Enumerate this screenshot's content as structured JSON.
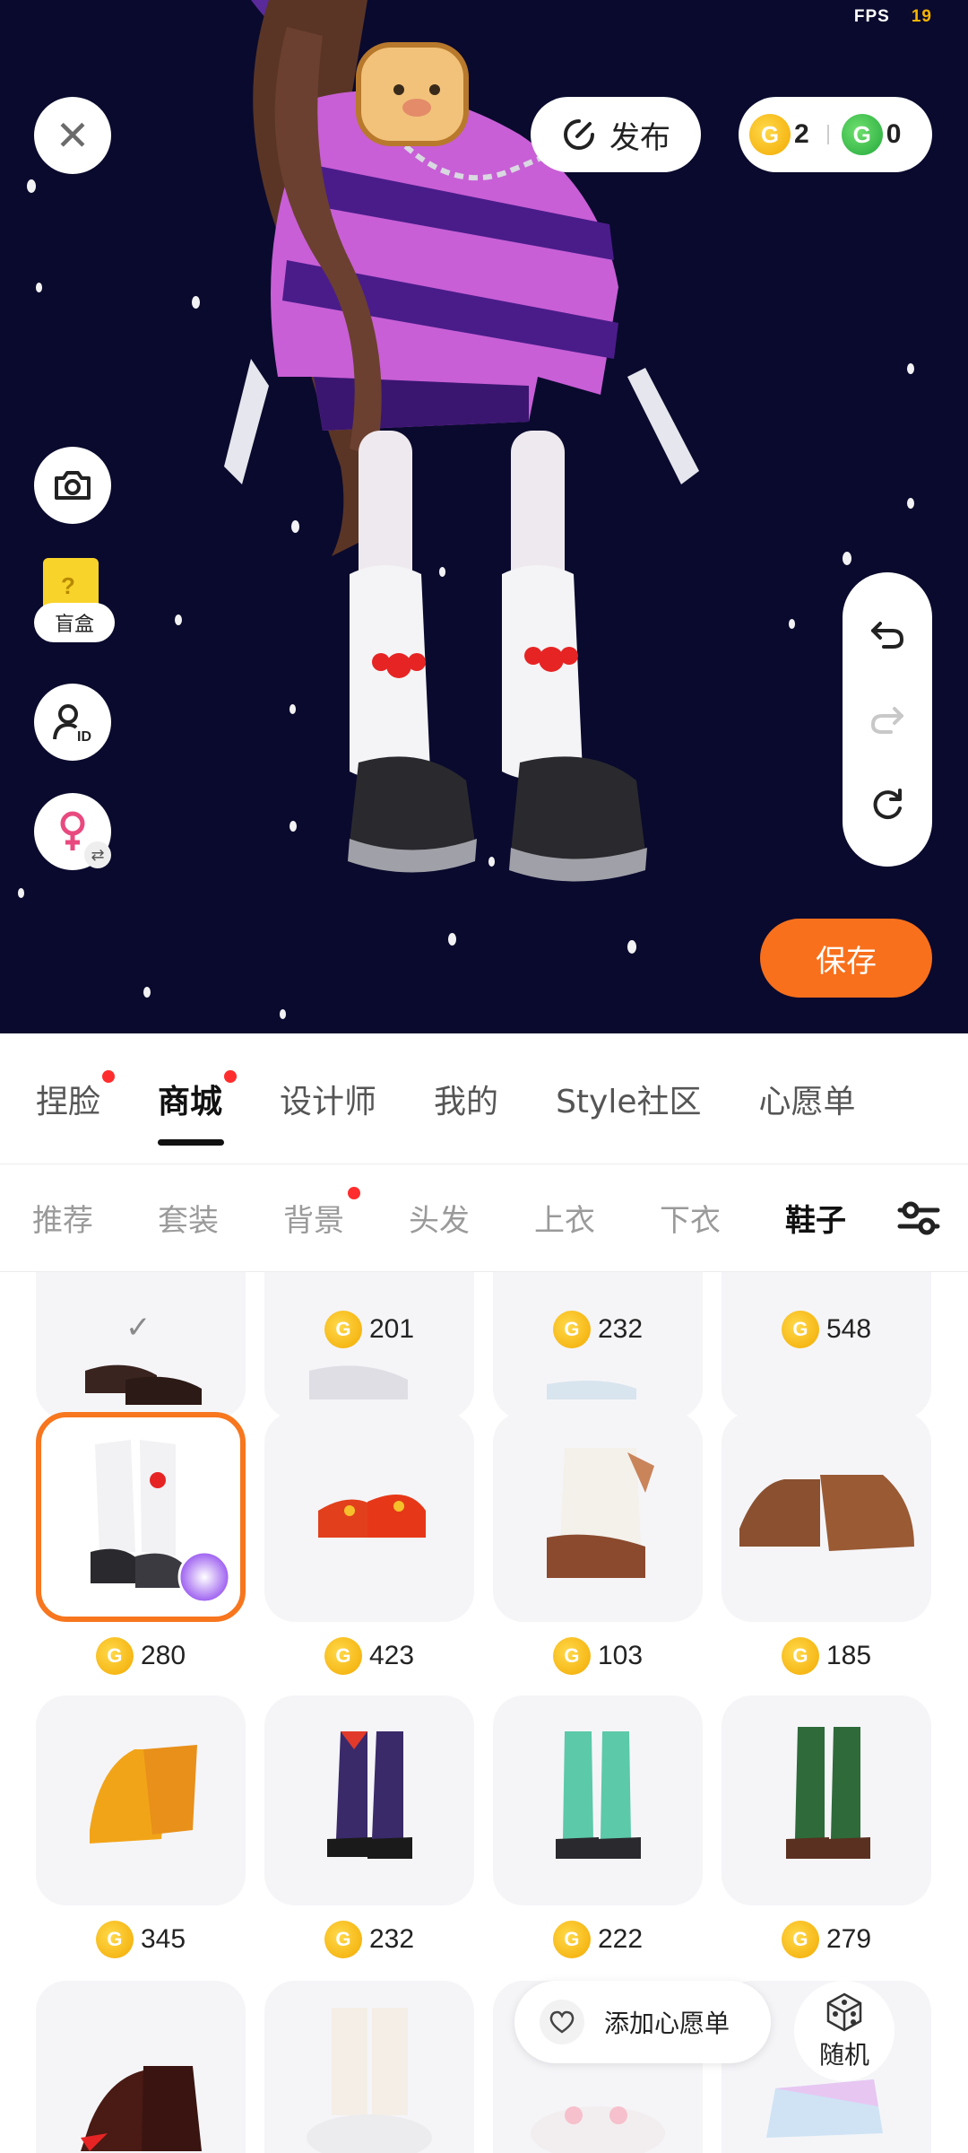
{
  "status": {
    "fps_label": "FPS",
    "fps_value": "19"
  },
  "toolbar": {
    "publish_label": "发布",
    "coins_gold": "2",
    "coins_green": "0",
    "blindbox_label": "盲盒",
    "save_label": "保存"
  },
  "main_tabs": [
    {
      "label": "捏脸",
      "dot": true
    },
    {
      "label": "商城",
      "dot": true,
      "active": true
    },
    {
      "label": "设计师"
    },
    {
      "label": "我的"
    },
    {
      "label": "Style社区"
    },
    {
      "label": "心愿单"
    }
  ],
  "sub_tabs": [
    {
      "label": "推荐"
    },
    {
      "label": "套装"
    },
    {
      "label": "背景",
      "dot": true
    },
    {
      "label": "头发"
    },
    {
      "label": "上衣"
    },
    {
      "label": "下衣"
    },
    {
      "label": "鞋子",
      "active": true
    }
  ],
  "items": [
    {
      "name": "dark-loafers",
      "owned": true
    },
    {
      "name": "white-sneakers",
      "price": "201"
    },
    {
      "name": "light-shoes",
      "price": "232"
    },
    {
      "name": "plain-shoes",
      "price": "548"
    },
    {
      "name": "white-legwarmer-platform-shoes",
      "price": "280",
      "selected": true
    },
    {
      "name": "red-embroidered-shoes",
      "price": "423"
    },
    {
      "name": "fluffy-bear-boots",
      "price": "103"
    },
    {
      "name": "brown-paw-slippers",
      "price": "185"
    },
    {
      "name": "yellow-monster-feet",
      "price": "345"
    },
    {
      "name": "argyle-sock-shoes",
      "price": "232"
    },
    {
      "name": "teal-print-socks",
      "price": "222"
    },
    {
      "name": "green-stripe-socks",
      "price": "279"
    },
    {
      "name": "red-claw-feet"
    },
    {
      "name": "bunny-slipper-socks"
    },
    {
      "name": "bunny-slippers"
    },
    {
      "name": "holo-ice-skates"
    }
  ],
  "floating": {
    "wishlist_label": "添加心愿单",
    "random_label": "随机"
  },
  "colors": {
    "accent": "#f8701c",
    "stage_bg": "#0a0a2e",
    "coin_gold": "#f2a900",
    "coin_green": "#22a83a",
    "notify_dot": "#ff2d2d"
  }
}
